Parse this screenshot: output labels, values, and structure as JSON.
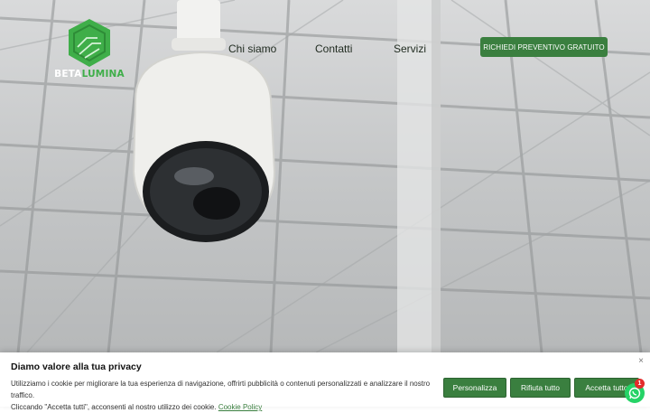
{
  "brand": {
    "name_part1": "BETA",
    "name_part2": "LUMINA",
    "color_green": "#3fae49"
  },
  "nav": {
    "items": [
      {
        "label": "Chi siamo"
      },
      {
        "label": "Contatti"
      },
      {
        "label": "Servizi"
      }
    ],
    "cta_label": "RICHIEDI PREVENTIVO GRATUITO"
  },
  "hero": {
    "image": "security-dome-camera-photo"
  },
  "cookie_banner": {
    "title": "Diamo valore alla tua privacy",
    "text_line1": "Utilizziamo i cookie per migliorare la tua esperienza di navigazione, offrirti pubblicità o contenuti personalizzati e analizzare il nostro traffico.",
    "text_line2": "Cliccando \"Accetta tutti\", acconsenti al nostro utilizzo dei cookie.",
    "policy_link": "Cookie Policy",
    "close_symbol": "×",
    "buttons": {
      "customize": "Personalizza",
      "reject": "Rifiuta tutto",
      "accept": "Accetta tutto"
    }
  },
  "whatsapp": {
    "icon": "whatsapp-icon",
    "badge_count": "1"
  },
  "colors": {
    "accent": "#3a7f3f"
  }
}
